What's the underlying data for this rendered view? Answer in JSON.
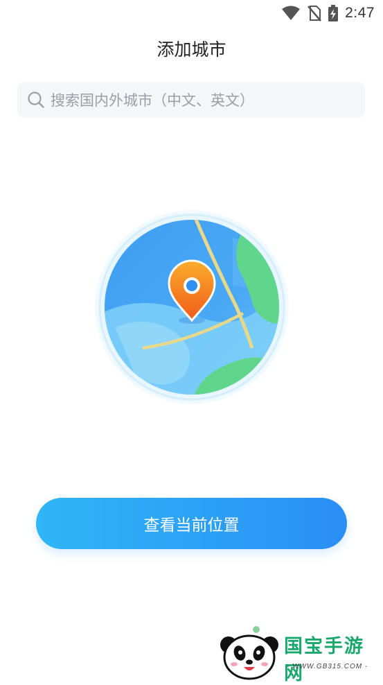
{
  "status_bar": {
    "time": "2:47",
    "icons": [
      "wifi-icon",
      "no-sim-icon",
      "battery-charging-icon"
    ]
  },
  "header": {
    "title": "添加城市"
  },
  "search": {
    "placeholder": "搜索国内外城市（中文、英文）",
    "icon": "search-icon"
  },
  "illustration": {
    "name": "location-globe",
    "icon": "map-pin-icon"
  },
  "actions": {
    "current_location_label": "查看当前位置"
  },
  "watermark": {
    "brand": "国宝手游网",
    "url": "- WWW.GB315.COM -"
  },
  "colors": {
    "accent_start": "#2fb6f7",
    "accent_end": "#2a8ef5",
    "pin_orange": "#f47b1e",
    "land_green": "#5fd68c",
    "search_bg": "#f5f6f8"
  }
}
